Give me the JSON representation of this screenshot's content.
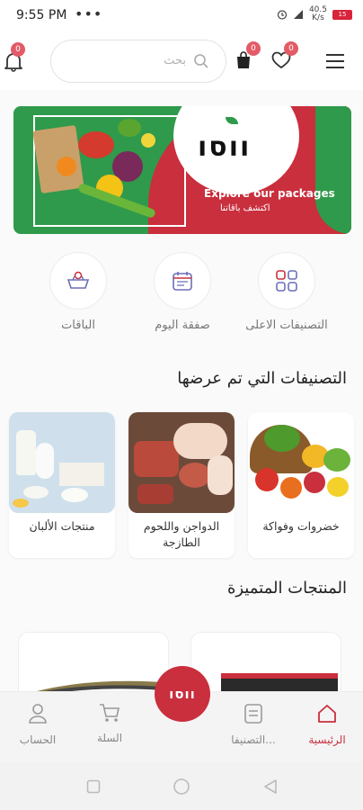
{
  "status": {
    "time": "9:55 PM",
    "dots": "•••",
    "speed": "40.5",
    "speed_unit": "K/s",
    "battery": "15"
  },
  "header": {
    "search_placeholder": "بحث",
    "notifications_badge": "0",
    "cart_badge": "0",
    "wishlist_badge": "0"
  },
  "banner": {
    "logo": "ווסו",
    "title": "Explore our packages",
    "subtitle": "اكتشف باقاتنا"
  },
  "quick": [
    {
      "label": "الباقات",
      "icon": "basket-icon"
    },
    {
      "label": "صفقة اليوم",
      "icon": "calendar-icon"
    },
    {
      "label": "التصنيفات الاعلى",
      "icon": "grid-icon"
    }
  ],
  "sections": {
    "viewed_categories": "التصنيفات التي تم عرضها",
    "featured_products": "المنتجات المتميزة"
  },
  "categories": [
    {
      "name": "منتجات الألبان"
    },
    {
      "name": "الدواجن واللحوم الطازجة"
    },
    {
      "name": "خضروات وفواكة"
    }
  ],
  "fab_logo": "ווסו",
  "nav": [
    {
      "label": "الحساب",
      "icon": "user-icon"
    },
    {
      "label": "السلة",
      "icon": "cart-icon"
    },
    {
      "label": "التصنيفا...",
      "icon": "list-icon"
    },
    {
      "label": "الرئيسية",
      "icon": "home-icon"
    }
  ],
  "colors": {
    "accent": "#c92f3d",
    "green": "#2f9a4b",
    "badge": "#e25b67"
  }
}
